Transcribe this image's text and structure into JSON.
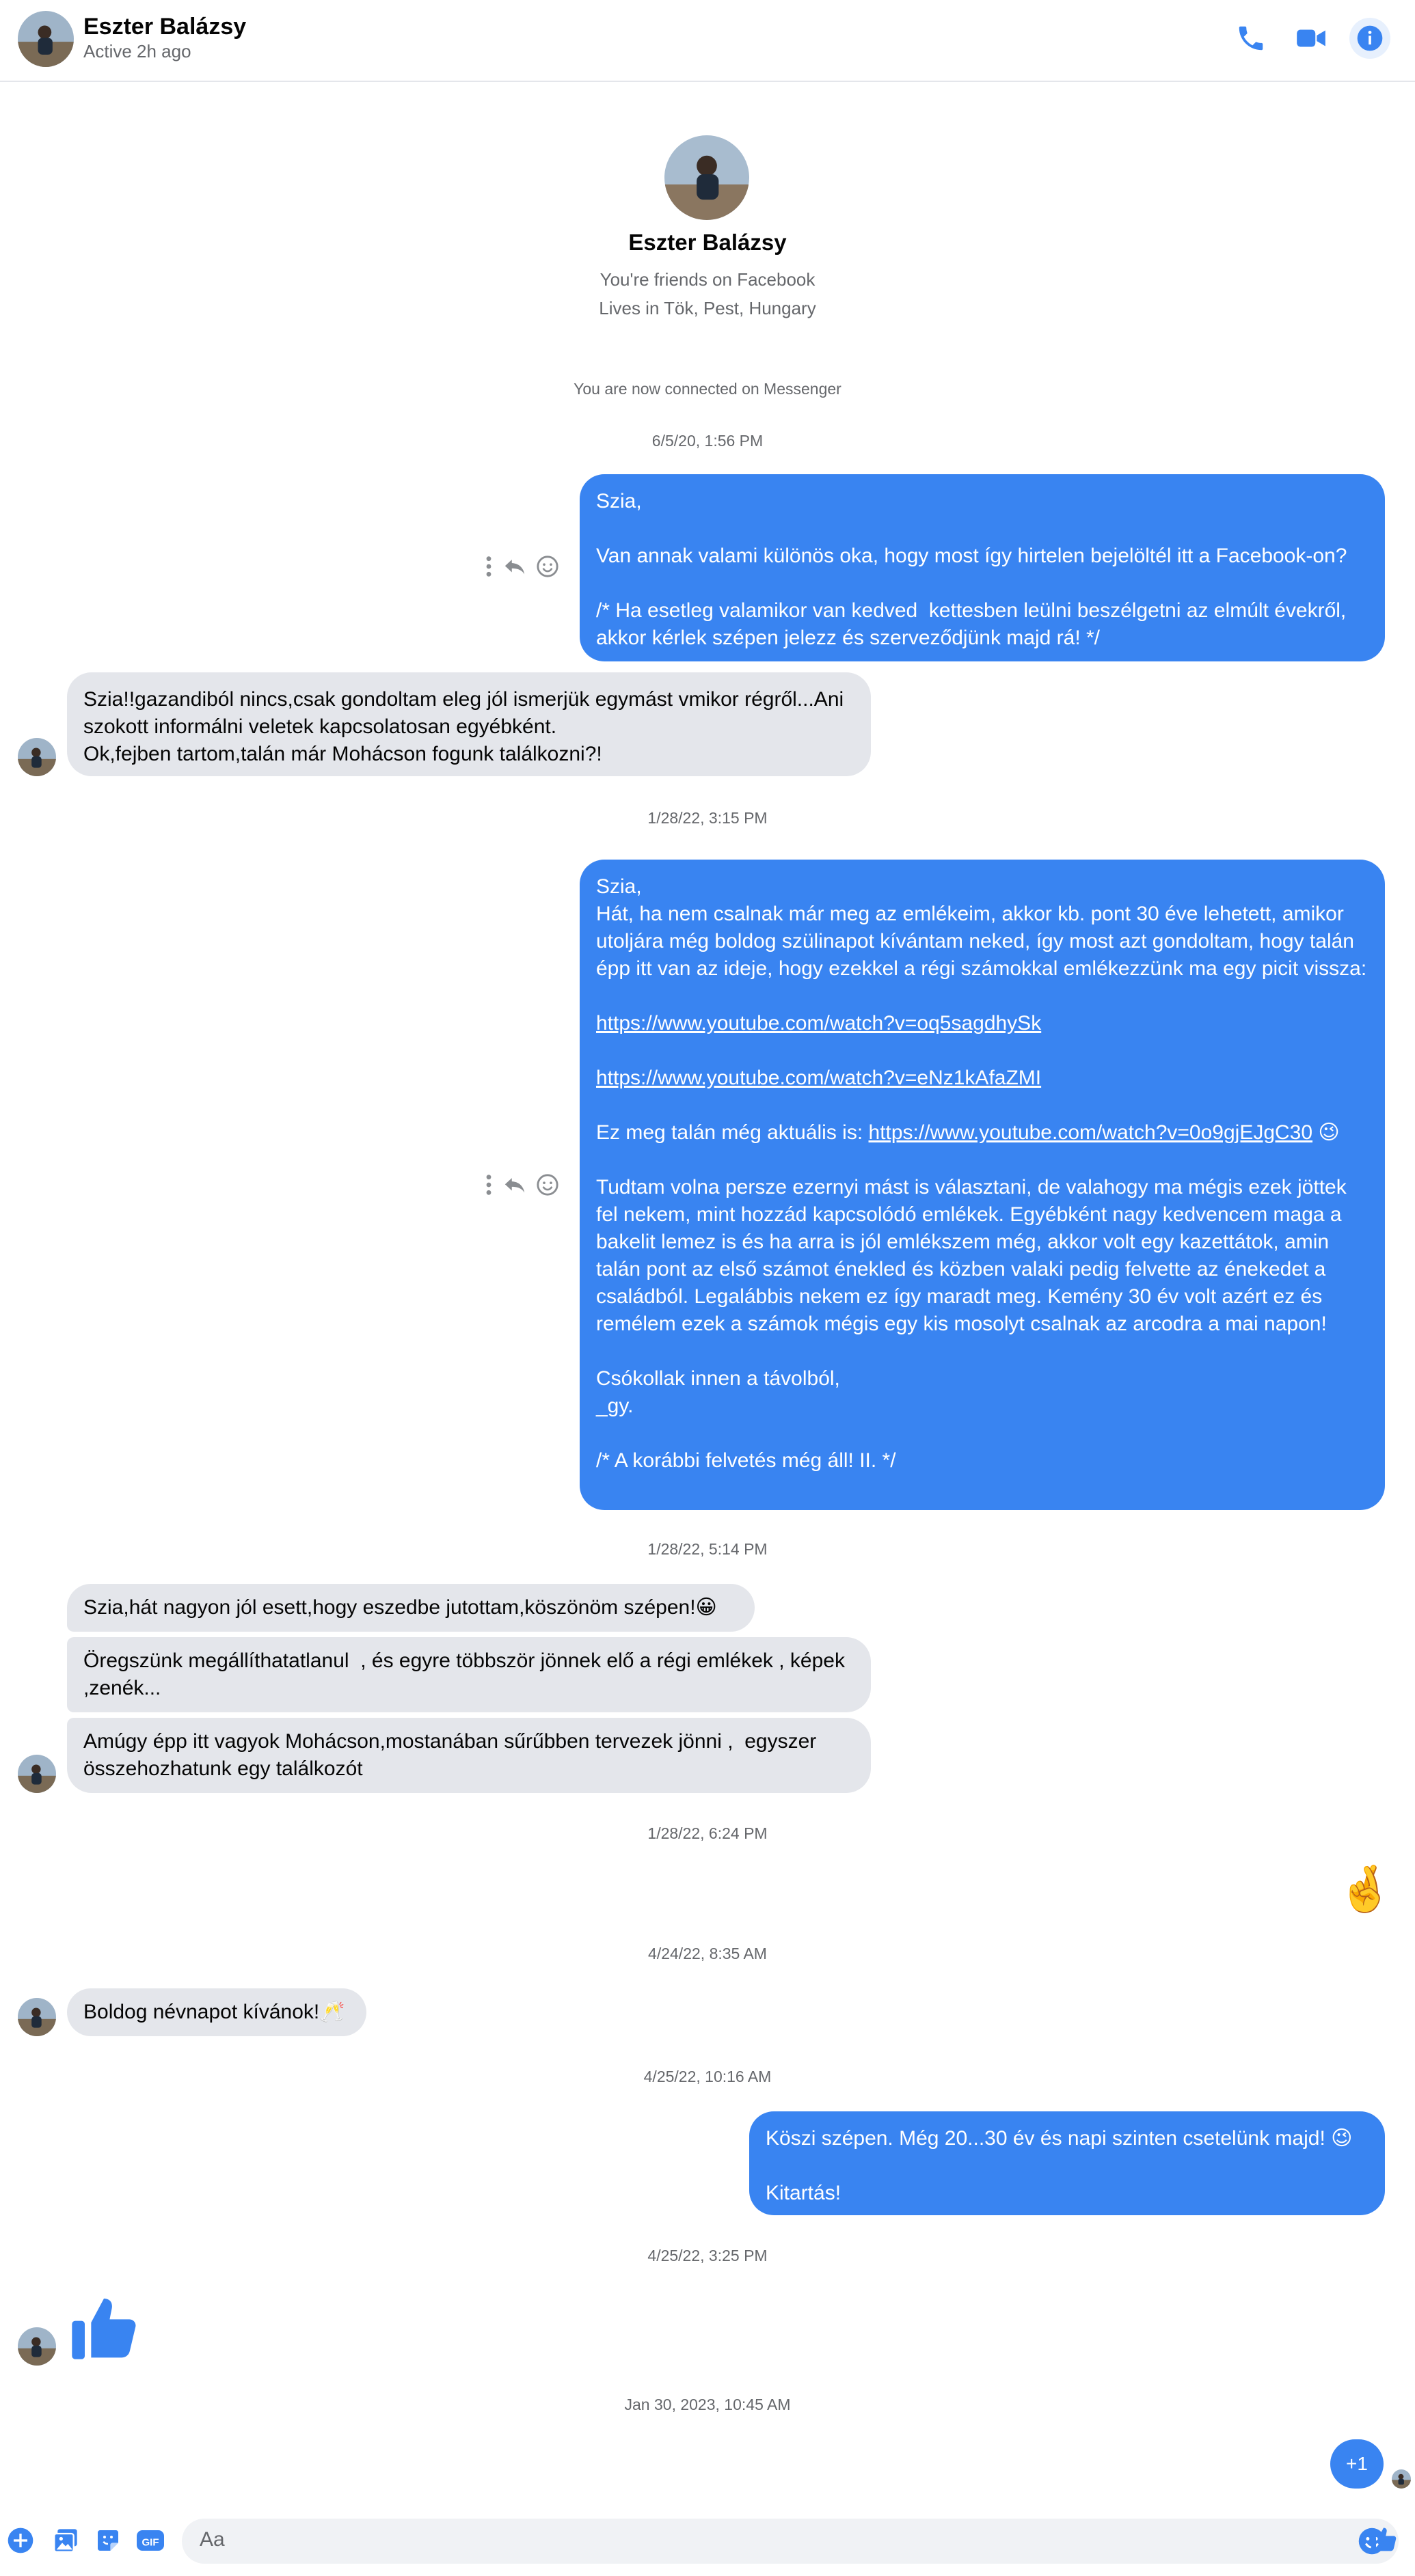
{
  "header": {
    "name": "Eszter Balázsy",
    "status": "Active 2h ago"
  },
  "profile": {
    "name": "Eszter Balázsy",
    "friends_line": "You're friends on Facebook",
    "lives_line": "Lives in Tök, Pest, Hungary"
  },
  "connected_notice": "You are now connected on Messenger",
  "timestamps": [
    "6/5/20, 1:56 PM",
    "1/28/22, 3:15 PM",
    "1/28/22, 5:14 PM",
    "1/28/22, 6:24 PM",
    "4/24/22, 8:35 AM",
    "4/25/22, 10:16 AM",
    "4/25/22, 3:25 PM",
    "Jan 30, 2023, 10:45 AM"
  ],
  "messages": {
    "m1_out": "Szia,\n\nVan annak valami különös oka, hogy most így hirtelen bejelöltél itt a Facebook-on?\n\n/* Ha esetleg valamikor van kedved  kettesben leülni beszélgetni az elmúlt évekről, akkor kérlek szépen jelezz és szerveződjünk majd rá! */",
    "m2_in": "Szia!!gazandiból nincs,csak gondoltam eleg jól ismerjük egymást vmikor régről...Ani szokott informálni veletek kapcsolatosan egyébként.\nOk,fejben tartom,talán már Mohácson fogunk találkozni?!",
    "m3_out_intro": "Szia,\nHát, ha nem csalnak már meg az emlékeim, akkor kb. pont 30 éve lehetett, amikor utoljára még boldog szülinapot kívántam neked, így most azt gondoltam, hogy talán épp itt van az ideje, hogy ezekkel a régi számokkal emlékezzünk ma egy picit vissza:",
    "m3_link1": "https://www.youtube.com/watch?v=oq5sagdhySk",
    "m3_link2": "https://www.youtube.com/watch?v=eNz1kAfaZMI",
    "m3_line_prefix": "Ez meg talán még aktuális is: ",
    "m3_link3": "https://www.youtube.com/watch?v=0o9gjEJgC30",
    "m3_emoji": "😉",
    "m3_body": "Tudtam volna persze ezernyi mást is választani, de valahogy ma mégis ezek jöttek fel nekem, mint hozzád kapcsolódó emlékek. Egyébként nagy kedvencem maga a bakelit lemez is és ha arra is jól emlékszem még, akkor volt egy kazettátok, amin talán pont az első számot énekled és közben valaki pedig felvette az énekedet a családból. Legalábbis nekem ez így maradt meg. Kemény 30 év volt azért ez és remélem ezek a számok mégis egy kis mosolyt csalnak az arcodra a mai napon!",
    "m3_sign": "Csókollak innen a távolból,\n_gy.",
    "m3_ps": "/* A korábbi felvetés még áll! II. */",
    "m4_in": "Szia,hát nagyon jól esett,hogy eszedbe jutottam,köszönöm szépen!😀",
    "m5_in": "Öregszünk megállíthatatlanul  , és egyre többször jönnek elő a régi emlékek , képek ,zenék...",
    "m6_in": "Amúgy épp itt vagyok Mohácson,mostanában sűrűbben tervezek jönni ,  egyszer összehozhatunk egy találkozót",
    "m7_out_emoji": "🤞",
    "m8_in": "Boldog névnapot kívánok!🥂",
    "m9_out": "Köszi szépen. Még 20...30 év és napi szinten csetelünk majd! 😉\n\nKitartás!",
    "m11_out": "+1"
  },
  "composer": {
    "placeholder": "Aa"
  },
  "colors": {
    "accent": "#3984f1",
    "incoming": "#e4e6eb",
    "muted_text": "#65676b"
  },
  "icons": [
    "phone-icon",
    "video-icon",
    "info-icon",
    "more-icon",
    "reply-icon",
    "react-icon",
    "plus-icon",
    "image-icon",
    "sticker-icon",
    "gif-icon",
    "emoji-icon",
    "like-icon"
  ]
}
